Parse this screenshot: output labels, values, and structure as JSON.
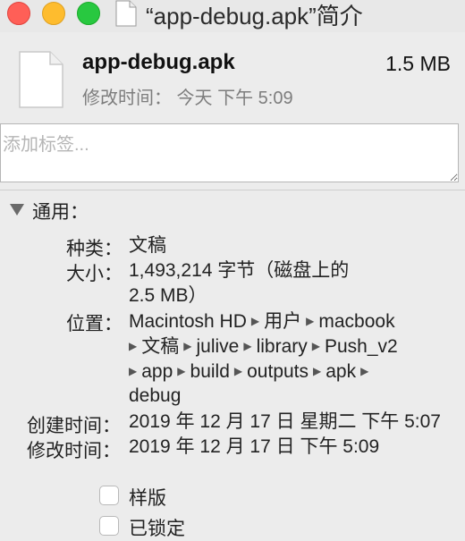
{
  "window": {
    "title": "“app-debug.apk”简介",
    "controls": [
      "close",
      "minimize",
      "zoom"
    ]
  },
  "header": {
    "icon": "document-icon",
    "file_name": "app-debug.apk",
    "file_size": "1.5 MB",
    "modified": "修改时间： 今天 下午 5:09"
  },
  "tags": {
    "placeholder": "添加标签...",
    "value": ""
  },
  "general": {
    "title": "通用：",
    "expanded": true,
    "kind_label": "种类：",
    "kind_value": "文稿",
    "size_label": "大小：",
    "size_line1": "1,493,214 字节（磁盘上的",
    "size_line2": "2.5 MB）",
    "location_label": "位置：",
    "location_path": [
      "Macintosh HD",
      "用户",
      "macbook",
      "文稿",
      "julive",
      "library",
      "Push_v2",
      "app",
      "build",
      "outputs",
      "apk",
      "debug"
    ],
    "created_label": "创建时间：",
    "created_value": "2019 年 12 月 17 日 星期二 下午 5:07",
    "modified_label": "修改时间：",
    "modified_value": "2019 年 12 月 17 日 下午 5:09",
    "stationery_label": "样版",
    "stationery_checked": false,
    "locked_label": "已锁定",
    "locked_checked": false
  }
}
